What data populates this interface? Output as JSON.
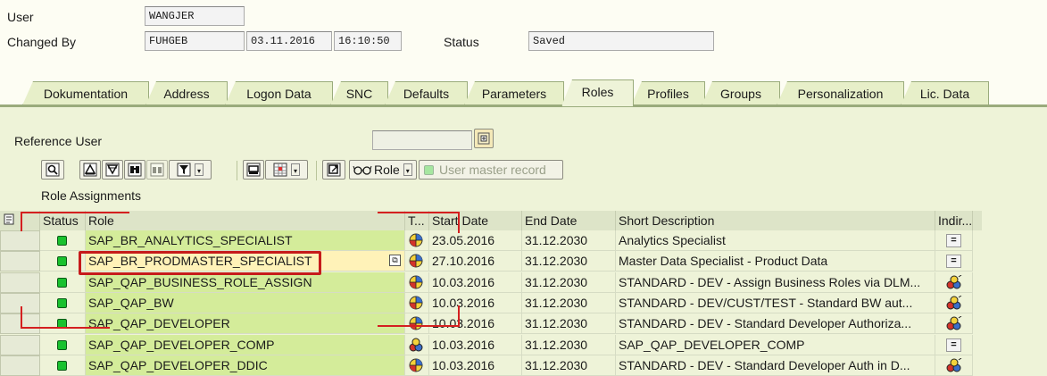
{
  "header": {
    "user_label": "User",
    "user_value": "WANGJER",
    "changed_by_label": "Changed By",
    "changed_by_value": "FUHGEB",
    "changed_date": "03.11.2016",
    "changed_time": "16:10:50",
    "status_label": "Status",
    "status_value": "Saved"
  },
  "tabs": [
    {
      "label": "Dokumentation",
      "active": false
    },
    {
      "label": "Address",
      "active": false
    },
    {
      "label": "Logon Data",
      "active": false
    },
    {
      "label": "SNC",
      "active": false
    },
    {
      "label": "Defaults",
      "active": false
    },
    {
      "label": "Parameters",
      "active": false
    },
    {
      "label": "Roles",
      "active": true
    },
    {
      "label": "Profiles",
      "active": false
    },
    {
      "label": "Groups",
      "active": false
    },
    {
      "label": "Personalization",
      "active": false
    },
    {
      "label": "Lic. Data",
      "active": false
    }
  ],
  "reference_user": {
    "label": "Reference User",
    "value": ""
  },
  "toolbar": {
    "role_label": "Role",
    "user_master_label": "User master record"
  },
  "section_title": "Role Assignments",
  "table": {
    "columns": {
      "status": "Status",
      "role": "Role",
      "type": "T...",
      "start": "Start Date",
      "end": "End Date",
      "desc": "Short Description",
      "indir": "Indir..."
    },
    "rows": [
      {
        "role": "SAP_BR_ANALYTICS_SPECIALIST",
        "start": "23.05.2016",
        "end": "31.12.2030",
        "desc": "Analytics Specialist",
        "type_icon": "globe-icon",
        "indir_icon": "single-role-icon"
      },
      {
        "role": "SAP_BR_PRODMASTER_SPECIALIST",
        "start": "27.10.2016",
        "end": "31.12.2030",
        "desc": "Master Data Specialist - Product Data",
        "type_icon": "globe-icon",
        "indir_icon": "single-role-icon"
      },
      {
        "role": "SAP_QAP_BUSINESS_ROLE_ASSIGN",
        "start": "10.03.2016",
        "end": "31.12.2030",
        "desc": "STANDARD - DEV -  Assign Business Roles via DLM...",
        "type_icon": "globe-icon",
        "indir_icon": "composite-role-icon"
      },
      {
        "role": "SAP_QAP_BW",
        "start": "10.03.2016",
        "end": "31.12.2030",
        "desc": "STANDARD - DEV/CUST/TEST - Standard BW aut...",
        "type_icon": "globe-icon",
        "indir_icon": "composite-role-icon"
      },
      {
        "role": "SAP_QAP_DEVELOPER",
        "start": "10.03.2016",
        "end": "31.12.2030",
        "desc": "STANDARD - DEV - Standard Developer Authoriza...",
        "type_icon": "globe-icon",
        "indir_icon": "composite-role-icon"
      },
      {
        "role": "SAP_QAP_DEVELOPER_COMP",
        "start": "10.03.2016",
        "end": "31.12.2030",
        "desc": "SAP_QAP_DEVELOPER_COMP",
        "type_icon": "composite-globe-icon",
        "indir_icon": "single-role-icon"
      },
      {
        "role": "SAP_QAP_DEVELOPER_DDIC",
        "start": "10.03.2016",
        "end": "31.12.2030",
        "desc": "STANDARD - DEV - Standard Developer Auth in D...",
        "type_icon": "globe-icon",
        "indir_icon": "composite-role-icon"
      }
    ]
  },
  "colors": {
    "panel_bg": "#eef3d8",
    "role_cell_bg": "#d4ec9a",
    "status_green": "#19c12e",
    "highlight_red": "#c61b1b"
  }
}
